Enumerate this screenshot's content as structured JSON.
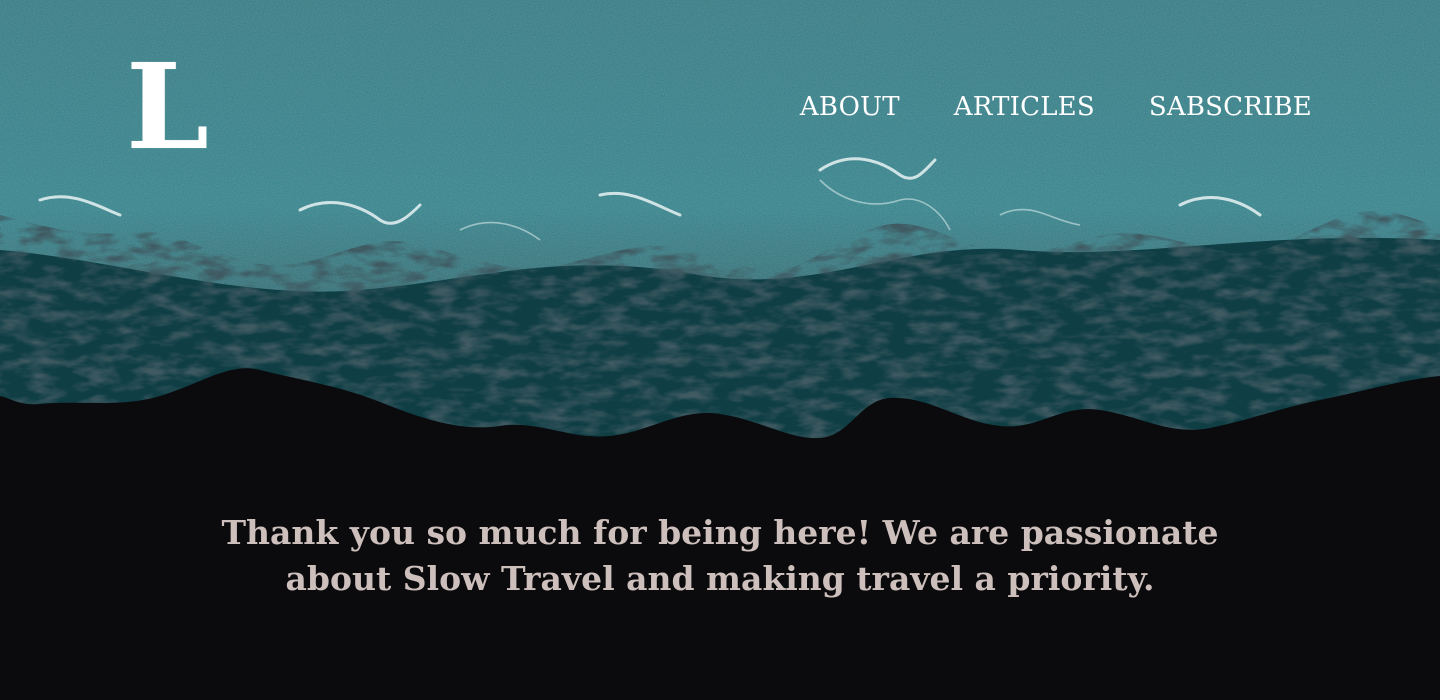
{
  "brand": {
    "logo_letter": "L"
  },
  "nav": {
    "items": [
      {
        "label": "ABOUT"
      },
      {
        "label": "ARTICLES"
      },
      {
        "label": "SABSCRIBE"
      }
    ]
  },
  "hero": {
    "tagline_line1": "Thank you so much for being here! We are passionate",
    "tagline_line2": "about Slow Travel and making travel a priority.",
    "colors": {
      "ocean": "#1f7e87",
      "foam": "#ffffff",
      "beach": "#0b0b0d",
      "tagline": "#cdbfbc"
    }
  }
}
